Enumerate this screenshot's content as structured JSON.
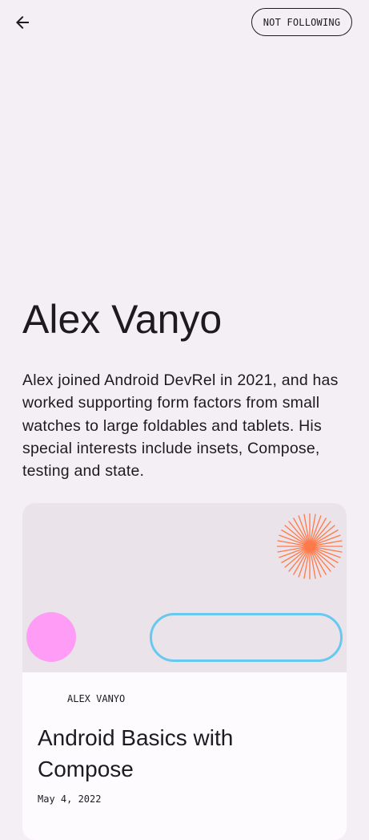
{
  "top_bar": {
    "back_icon": "arrow-back-icon",
    "follow_label": "NOT FOLLOWING"
  },
  "author": {
    "name": "Alex Vanyo",
    "bio": "Alex joined Android DevRel in 2021, and has worked supporting form factors from small watches to large foldables and tablets. His special interests include insets, Compose, testing and state."
  },
  "card": {
    "header_colors": {
      "background": "#ebe3ea",
      "burst": "#ff7a4a",
      "circle": "#ff9cf5",
      "pill": "#68c8f0"
    },
    "author_label": "ALEX VANYO",
    "title": "Android Basics with Compose",
    "date": "May 4, 2022"
  }
}
